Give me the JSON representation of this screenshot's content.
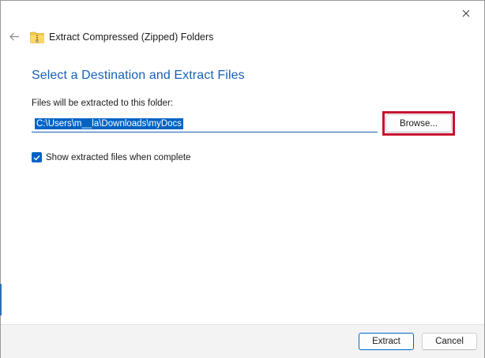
{
  "window": {
    "title": "Extract Compressed (Zipped) Folders"
  },
  "main": {
    "heading": "Select a Destination and Extract Files",
    "destination_label": "Files will be extracted to this folder:",
    "destination_path": "C:\\Users\\m__la\\Downloads\\myDocs",
    "browse_label": "Browse...",
    "show_files_label": "Show extracted files when complete",
    "show_files_checked": true
  },
  "footer": {
    "extract_label": "Extract",
    "cancel_label": "Cancel"
  },
  "colors": {
    "accent": "#0063c4",
    "heading": "#1a5fb4",
    "highlight": "#c8102e"
  },
  "icons": {
    "close": "close-icon",
    "back": "back-arrow-icon",
    "folder": "zip-folder-icon",
    "check": "checkmark-icon"
  }
}
